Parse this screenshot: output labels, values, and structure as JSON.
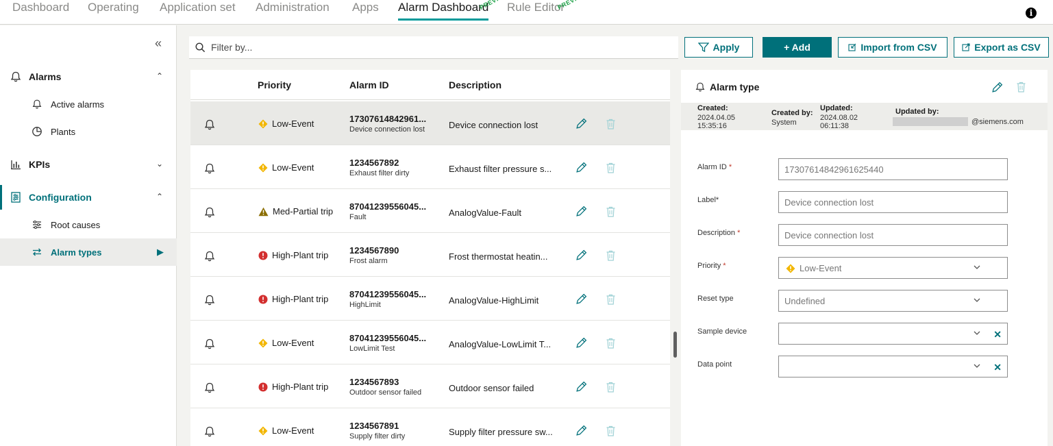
{
  "nav": {
    "tabs": [
      {
        "label": "Dashboard"
      },
      {
        "label": "Operating"
      },
      {
        "label": "Application set"
      },
      {
        "label": "Administration"
      },
      {
        "label": "Apps"
      },
      {
        "label": "Alarm Dashboard",
        "badge": "PREVIEW"
      },
      {
        "label": "Rule Editor",
        "badge": "PREVIEW"
      }
    ],
    "active": "Alarm Dashboard"
  },
  "sidebar": {
    "groups": [
      {
        "label": "Alarms",
        "items": [
          {
            "label": "Active alarms"
          },
          {
            "label": "Plants"
          }
        ]
      },
      {
        "label": "KPIs"
      },
      {
        "label": "Configuration",
        "items": [
          {
            "label": "Root causes"
          },
          {
            "label": "Alarm types"
          }
        ]
      }
    ],
    "active_item": "Alarm types"
  },
  "toolbar": {
    "filter_placeholder": "Filter by...",
    "apply_label": "Apply",
    "add_label": "+ Add",
    "import_label": "Import from CSV",
    "export_label": "Export as CSV"
  },
  "table": {
    "columns": [
      "Priority",
      "Alarm ID",
      "Description"
    ],
    "rows": [
      {
        "priority": "Low-Event",
        "level": "low",
        "id": "17307614842961...",
        "label": "Device connection lost",
        "description": "Device connection lost",
        "selected": true
      },
      {
        "priority": "Low-Event",
        "level": "low",
        "id": "1234567892",
        "label": "Exhaust filter dirty",
        "description": "Exhaust filter pressure s..."
      },
      {
        "priority": "Med-Partial trip",
        "level": "med",
        "id": "87041239556045...",
        "label": "Fault",
        "description": "AnalogValue-Fault"
      },
      {
        "priority": "High-Plant trip",
        "level": "high",
        "id": "1234567890",
        "label": "Frost alarm",
        "description": "Frost thermostat heatin..."
      },
      {
        "priority": "High-Plant trip",
        "level": "high",
        "id": "87041239556045...",
        "label": "HighLimit",
        "description": "AnalogValue-HighLimit"
      },
      {
        "priority": "Low-Event",
        "level": "low",
        "id": "87041239556045...",
        "label": "LowLimit Test",
        "description": "AnalogValue-LowLimit T..."
      },
      {
        "priority": "High-Plant trip",
        "level": "high",
        "id": "1234567893",
        "label": "Outdoor sensor failed",
        "description": "Outdoor sensor failed"
      },
      {
        "priority": "Low-Event",
        "level": "low",
        "id": "1234567891",
        "label": "Supply filter dirty",
        "description": "Supply filter pressure sw..."
      }
    ]
  },
  "detail": {
    "title": "Alarm type",
    "created_label": "Created:",
    "created_date": "2024.04.05",
    "created_time": "15:35:16",
    "created_by_label": "Created by:",
    "created_by": "System",
    "updated_label": "Updated:",
    "updated_date": "2024.08.02",
    "updated_time": "06:11:38",
    "updated_by_label": "Updated by:",
    "updated_by": "@siemens.com",
    "fields": {
      "alarm_id": {
        "label": "Alarm ID",
        "required": true,
        "value": "17307614842961625440"
      },
      "label": {
        "label": "Label*",
        "value": "Device connection lost"
      },
      "description": {
        "label": "Description",
        "required": true,
        "value": "Device connection lost"
      },
      "priority": {
        "label": "Priority",
        "required": true,
        "value": "Low-Event"
      },
      "reset_type": {
        "label": "Reset type",
        "value": "Undefined"
      },
      "sample_device": {
        "label": "Sample device",
        "value": ""
      },
      "data_point": {
        "label": "Data point",
        "value": ""
      }
    }
  },
  "colors": {
    "accent": "#00707a",
    "low": "#f2b600",
    "med": "#8a6d00",
    "high": "#d32f2f"
  }
}
